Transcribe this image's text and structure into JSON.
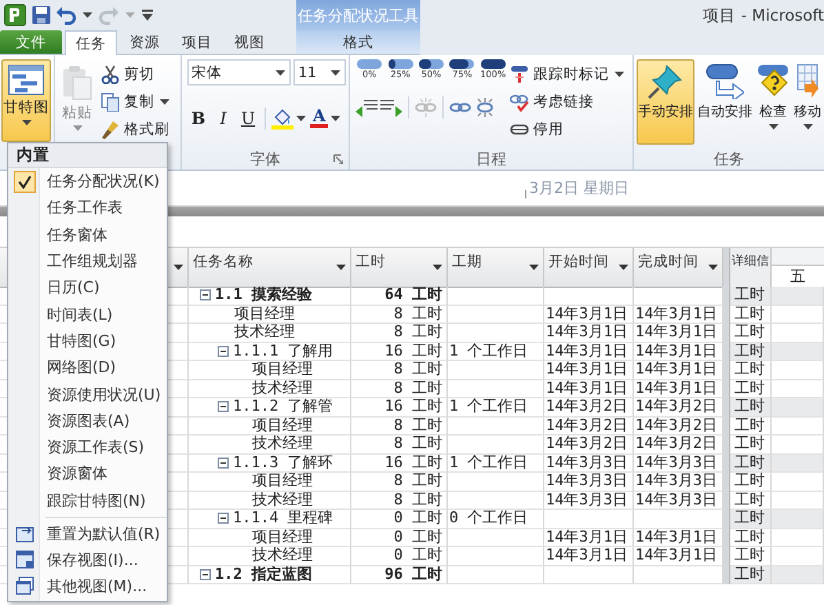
{
  "window": {
    "title": "项目 - Microsoft",
    "context_tool": "任务分配状况工具"
  },
  "tabs": [
    {
      "label": "文件",
      "kind": "file",
      "selected": false
    },
    {
      "label": "任务",
      "kind": "tab",
      "selected": true
    },
    {
      "label": "资源",
      "kind": "tab",
      "selected": false
    },
    {
      "label": "项目",
      "kind": "tab",
      "selected": false
    },
    {
      "label": "视图",
      "kind": "tab",
      "selected": false
    },
    {
      "label": "格式",
      "kind": "contextual",
      "selected": false
    }
  ],
  "ribbon": {
    "view_button": {
      "label": "甘特图",
      "pressed": true
    },
    "clipboard": {
      "paste": {
        "label": "粘贴",
        "disabled": true
      },
      "items": [
        {
          "label": "剪切",
          "kind": "cut",
          "dropdown": false
        },
        {
          "label": "复制",
          "kind": "copy",
          "dropdown": true
        },
        {
          "label": "格式刷",
          "kind": "brush",
          "dropdown": false
        }
      ]
    },
    "font": {
      "title": "字体",
      "font_name": "宋体",
      "font_size": "11",
      "styles": [
        "B",
        "I",
        "U"
      ],
      "font_color": "A"
    },
    "schedule": {
      "title": "日程",
      "percent_buttons": [
        "0%",
        "25%",
        "50%",
        "75%",
        "100%"
      ],
      "items": [
        {
          "label": "跟踪时标记",
          "kind": "marker",
          "dropdown": true
        },
        {
          "label": "考虑链接",
          "kind": "links",
          "dropdown": false
        },
        {
          "label": "停用",
          "kind": "inactive",
          "dropdown": false
        }
      ]
    },
    "tasks": {
      "title": "任务",
      "buttons": [
        {
          "label": "手动安排",
          "kind": "manual",
          "selected": true,
          "dropdown": false
        },
        {
          "label": "自动安排",
          "kind": "auto",
          "selected": false,
          "dropdown": false
        },
        {
          "label": "检查",
          "kind": "inspect",
          "selected": false,
          "dropdown": true
        },
        {
          "label": "移动",
          "kind": "move",
          "selected": false,
          "dropdown": true
        }
      ]
    }
  },
  "timeline": {
    "date_label": "3月2日 星期日"
  },
  "table": {
    "columns": [
      "任务名称",
      "工时",
      "工期",
      "开始时间",
      "完成时间"
    ],
    "detail_header": "详细信",
    "timescale": "五",
    "rows": [
      {
        "kind": "summary",
        "name": "1.1 摸索经验",
        "work": "64 工时",
        "detail": "工时",
        "expanded": true,
        "children": [
          {
            "kind": "assignment",
            "name": "项目经理",
            "work": "8 工时",
            "start": "14年3月1日",
            "finish": "14年3月1日",
            "detail": "工时"
          },
          {
            "kind": "assignment",
            "name": "技术经理",
            "work": "8 工时",
            "start": "14年3月1日",
            "finish": "14年3月1日",
            "detail": "工时"
          },
          {
            "kind": "task",
            "name": "1.1.1 了解用",
            "work": "16 工时",
            "duration": "1 个工作日",
            "start": "14年3月1日",
            "finish": "14年3月1日",
            "detail": "工时",
            "expanded": true,
            "children": [
              {
                "kind": "assignment",
                "name": "项目经理",
                "work": "8 工时",
                "start": "14年3月1日",
                "finish": "14年3月1日",
                "detail": "工时"
              },
              {
                "kind": "assignment",
                "name": "技术经理",
                "work": "8 工时",
                "start": "14年3月1日",
                "finish": "14年3月1日",
                "detail": "工时"
              }
            ]
          },
          {
            "kind": "task",
            "name": "1.1.2 了解管",
            "work": "16 工时",
            "duration": "1 个工作日",
            "start": "14年3月2日",
            "finish": "14年3月2日",
            "detail": "工时",
            "expanded": true,
            "children": [
              {
                "kind": "assignment",
                "name": "项目经理",
                "work": "8 工时",
                "start": "14年3月2日",
                "finish": "14年3月2日",
                "detail": "工时"
              },
              {
                "kind": "assignment",
                "name": "技术经理",
                "work": "8 工时",
                "start": "14年3月2日",
                "finish": "14年3月2日",
                "detail": "工时"
              }
            ]
          },
          {
            "kind": "task",
            "name": "1.1.3 了解环",
            "work": "16 工时",
            "duration": "1 个工作日",
            "start": "14年3月3日",
            "finish": "14年3月3日",
            "detail": "工时",
            "expanded": true,
            "children": [
              {
                "kind": "assignment",
                "name": "项目经理",
                "work": "8 工时",
                "start": "14年3月3日",
                "finish": "14年3月3日",
                "detail": "工时"
              },
              {
                "kind": "assignment",
                "name": "技术经理",
                "work": "8 工时",
                "start": "14年3月3日",
                "finish": "14年3月3日",
                "detail": "工时"
              }
            ]
          },
          {
            "kind": "task",
            "name": "1.1.4 里程碑",
            "work": "0 工时",
            "duration": "0 个工作日",
            "detail": "工时",
            "expanded": true,
            "children": [
              {
                "kind": "assignment",
                "name": "项目经理",
                "work": "0 工时",
                "start": "14年3月1日",
                "finish": "14年3月1日",
                "detail": "工时"
              },
              {
                "kind": "assignment",
                "name": "技术经理",
                "work": "0 工时",
                "start": "14年3月1日",
                "finish": "14年3月1日",
                "detail": "工时"
              }
            ]
          }
        ]
      },
      {
        "kind": "summary",
        "name": "1.2 指定蓝图",
        "work": "96 工时",
        "detail": "工时",
        "expanded": true
      }
    ]
  },
  "menu": {
    "header": "内置",
    "views": [
      {
        "label": "任务分配状况(K)",
        "selected": true
      },
      {
        "label": "任务工作表",
        "selected": false
      },
      {
        "label": "任务窗体",
        "selected": false
      },
      {
        "label": "工作组规划器",
        "selected": false
      },
      {
        "label": "日历(C)",
        "selected": false
      },
      {
        "label": "时间表(L)",
        "selected": false
      },
      {
        "label": "甘特图(G)",
        "selected": false
      },
      {
        "label": "网络图(D)",
        "selected": false
      },
      {
        "label": "资源使用状况(U)",
        "selected": false
      },
      {
        "label": "资源图表(A)",
        "selected": false
      },
      {
        "label": "资源工作表(S)",
        "selected": false
      },
      {
        "label": "资源窗体",
        "selected": false
      },
      {
        "label": "跟踪甘特图(N)",
        "selected": false
      }
    ],
    "actions": [
      {
        "label": "重置为默认值(R)",
        "kind": "reset"
      },
      {
        "label": "保存视图(I)...",
        "kind": "save"
      },
      {
        "label": "其他视图(M)...",
        "kind": "more"
      }
    ]
  }
}
